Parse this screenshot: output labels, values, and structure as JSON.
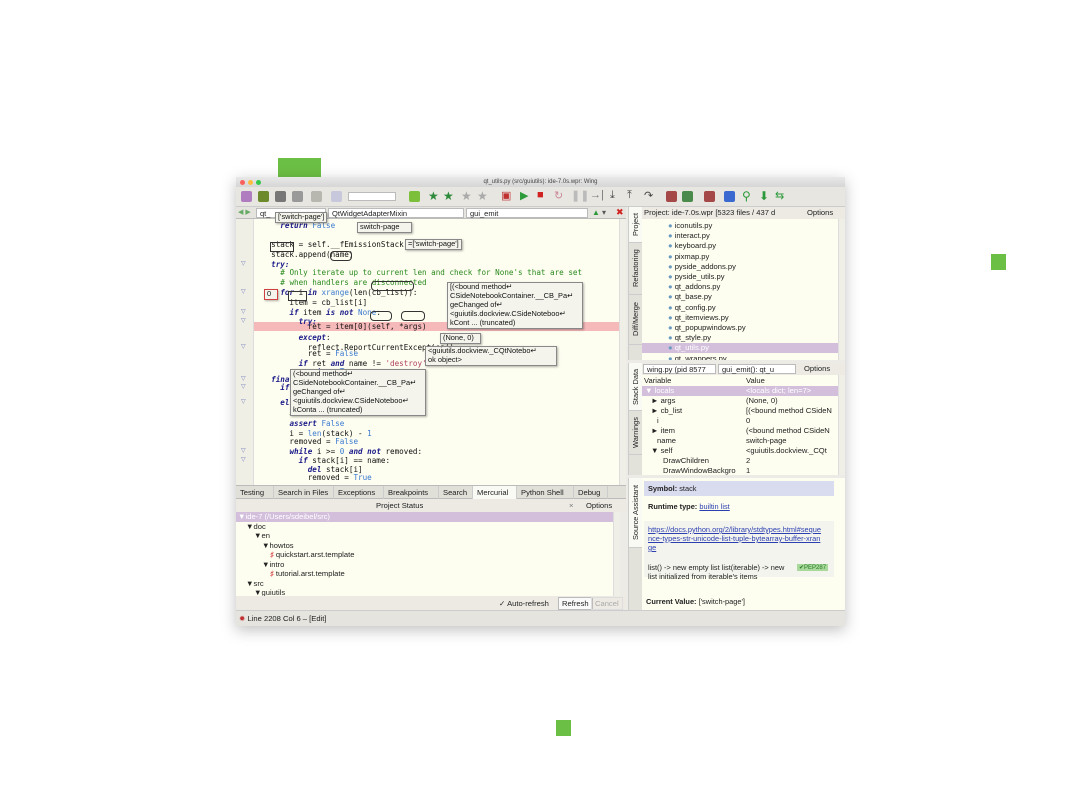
{
  "window": {
    "title": "qt_utils.py (src/guiutils): ide-7.0s.wpr: Wing"
  },
  "colors": {
    "accent_green": "#6cbf45",
    "selection": "#d3bfdc",
    "error_line": "#f6b9ba"
  },
  "editor": {
    "class_combo": "QtWidgetAdapterMixin",
    "file_combo": "qt_",
    "func_combo": "gui_emit",
    "code": [
      [
        [
          "    "
        ],
        [
          "return ",
          "kw"
        ],
        [
          "False",
          "nb"
        ]
      ],
      [
        [
          ""
        ]
      ],
      [
        [
          "  stack = self.__fEmissionStack"
        ]
      ],
      [
        [
          "  stack.append(name)"
        ]
      ],
      [
        [
          "  "
        ],
        [
          "try:",
          "kw"
        ]
      ],
      [
        [
          "    "
        ],
        [
          "# Only iterate up to current len and check for None's that are set",
          "cm"
        ]
      ],
      [
        [
          "    "
        ],
        [
          "# when handlers are disconnected",
          "cm"
        ]
      ],
      [
        [
          "    "
        ],
        [
          "for ",
          "kw"
        ],
        [
          "i "
        ],
        [
          "in ",
          "kw"
        ],
        [
          "xrange",
          "nb"
        ],
        [
          "(len(cb_list)):"
        ]
      ],
      [
        [
          "      item = cb_list[i]"
        ]
      ],
      [
        [
          "      "
        ],
        [
          "if ",
          "kw"
        ],
        [
          "item "
        ],
        [
          "is not ",
          "kw"
        ],
        [
          "None",
          "nb"
        ],
        [
          ":"
        ]
      ],
      [
        [
          "        "
        ],
        [
          "try:",
          "kw"
        ]
      ],
      [
        [
          "          ret = item[0](self, *args)"
        ]
      ],
      [
        [
          "        "
        ],
        [
          "except",
          "kw"
        ],
        [
          ":"
        ]
      ],
      [
        [
          "          reflect.ReportCurrentException()"
        ]
      ],
      [
        [
          "          ret = "
        ],
        [
          "False",
          "nb"
        ]
      ],
      [
        [
          "        "
        ],
        [
          "if ",
          "kw"
        ],
        [
          "ret "
        ],
        [
          "and ",
          "kw"
        ],
        [
          "name != "
        ],
        [
          "'destroy'",
          "st"
        ]
      ],
      [
        [
          "          "
        ],
        [
          "return ",
          "kw"
        ],
        [
          "True",
          "nb"
        ]
      ],
      [
        [
          "  "
        ],
        [
          "finally",
          "kw"
        ],
        [
          ":"
        ]
      ],
      [
        [
          "    "
        ],
        [
          "if",
          "kw"
        ]
      ],
      [
        [
          ""
        ]
      ],
      [
        [
          "    "
        ],
        [
          "else",
          "kw"
        ],
        [
          ":"
        ]
      ],
      [
        [
          "      "
        ],
        [
          "# recover",
          "cm"
        ]
      ],
      [
        [
          "      "
        ],
        [
          "assert ",
          "kw"
        ],
        [
          "False",
          "nb"
        ]
      ],
      [
        [
          "      i = "
        ],
        [
          "len",
          "nb"
        ],
        [
          "(stack) - "
        ],
        [
          "1",
          "nb"
        ]
      ],
      [
        [
          "      removed = "
        ],
        [
          "False",
          "nb"
        ]
      ],
      [
        [
          "      "
        ],
        [
          "while ",
          "kw"
        ],
        [
          "i >= "
        ],
        [
          "0 ",
          "nb"
        ],
        [
          "and not ",
          "kw"
        ],
        [
          "removed:"
        ]
      ],
      [
        [
          "        "
        ],
        [
          "if ",
          "kw"
        ],
        [
          "stack[i] == name:"
        ]
      ],
      [
        [
          "          "
        ],
        [
          "del ",
          "kw"
        ],
        [
          "stack[i]"
        ]
      ],
      [
        [
          "          removed = "
        ],
        [
          "True",
          "nb"
        ]
      ]
    ],
    "tooltips": {
      "t1": "['switch-page']",
      "t2": "switch-page",
      "t3": "=['switch-page']",
      "t4": "0",
      "t5": "[(<bound method↵\nCSideNotebookContainer.__CB_Pa↵\ngeChanged of↵\n<guiutils.dockview.CSideNoteboo↵\nkCont ... (truncated)",
      "t6": "(None, 0)",
      "t7": "<guiutils.dockview._CQtNotebo↵\nok object>",
      "t8": "(<bound method↵\nCSideNotebookContainer.__CB_Pa↵\ngeChanged of↵\n<guiutils.dockview.CSideNoteboo↵\nkConta ... (truncated)"
    }
  },
  "bottom": {
    "tabs": [
      "Testing",
      "Search in Files",
      "Exceptions",
      "Breakpoints",
      "Search",
      "Mercurial",
      "Python Shell",
      "Debug"
    ],
    "active_tab": "Mercurial",
    "header": "Project Status",
    "options": "Options",
    "tree": [
      {
        "label": "ide-7 (/Users/sdeibel/src)",
        "level": 0,
        "selected": true
      },
      {
        "label": "doc",
        "level": 1
      },
      {
        "label": "en",
        "level": 2
      },
      {
        "label": "howtos",
        "level": 3
      },
      {
        "label": "quickstart.arst.template",
        "level": 4,
        "file": true
      },
      {
        "label": "intro",
        "level": 3
      },
      {
        "label": "tutorial.arst.template",
        "level": 4,
        "file": true
      },
      {
        "label": "src",
        "level": 1
      },
      {
        "label": "guiutils",
        "level": 2
      }
    ],
    "auto_refresh": "Auto-refresh",
    "refresh": "Refresh",
    "cancel": "Cancel"
  },
  "status": {
    "text": "Line 2208 Col 6 – [Edit]"
  },
  "project": {
    "tabs": [
      "Project",
      "Refactoring",
      "Diff/Merge"
    ],
    "header": "Project: ide-7.0s.wpr [5323 files / 437 d",
    "options": "Options",
    "files": [
      "iconutils.py",
      "interact.py",
      "keyboard.py",
      "pixmap.py",
      "pyside_addons.py",
      "pyside_utils.py",
      "qt_addons.py",
      "qt_base.py",
      "qt_config.py",
      "qt_itemviews.py",
      "qt_popupwindows.py",
      "qt_style.py",
      "qt_utils.py",
      "qt_wrappers.py"
    ],
    "selected": "qt_utils.py"
  },
  "stack": {
    "tabs": [
      "Stack Data",
      "Warnings"
    ],
    "process": "wing.py (pid 8577",
    "frame": "gui_emit(): qt_u",
    "options": "Options",
    "col_var": "Variable",
    "col_val": "Value",
    "rows": [
      {
        "name": "▼ locals",
        "value": "<locals dict; len=7>",
        "indent": 0,
        "selected": true
      },
      {
        "name": "► args",
        "value": "(None, 0)",
        "indent": 1
      },
      {
        "name": "► cb_list",
        "value": "[(<bound method CSideN",
        "indent": 1
      },
      {
        "name": "i",
        "value": "0",
        "indent": 2
      },
      {
        "name": "► item",
        "value": "(<bound method CSideN",
        "indent": 1
      },
      {
        "name": "name",
        "value": "switch-page",
        "indent": 2
      },
      {
        "name": "▼ self",
        "value": "<guiutils.dockview._CQt",
        "indent": 1
      },
      {
        "name": "DrawChildren",
        "value": "2",
        "indent": 3
      },
      {
        "name": "DrawWindowBackgro",
        "value": "1",
        "indent": 3
      }
    ]
  },
  "assistant": {
    "tab": "Source Assistant",
    "symbol_label": "Symbol:",
    "symbol": "stack",
    "rtype_label": "Runtime type:",
    "rtype": "builtin list",
    "link": "https://docs.python.org/2/library/stdtypes.html#sequence-types-str-unicode-list-tuple-bytearray-buffer-xrange",
    "doc": "list() -> new empty list list(iterable) -> new list initialized from iterable's items",
    "pep": "✔PEP287",
    "cv_label": "Current Value:",
    "cv": "['switch-page']"
  }
}
